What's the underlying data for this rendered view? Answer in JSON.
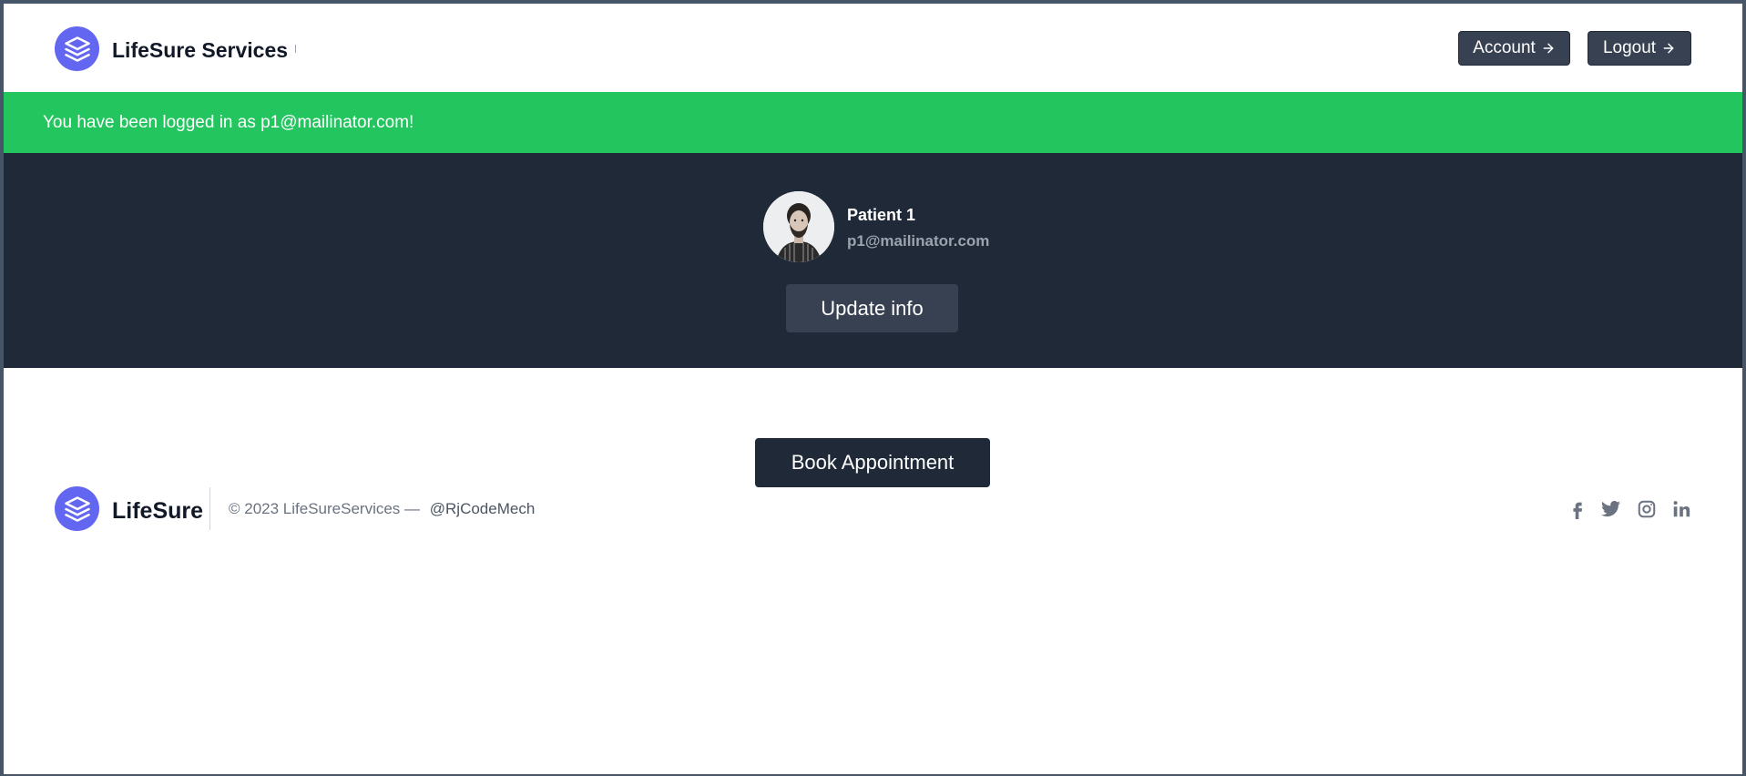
{
  "header": {
    "brand_name": "LifeSure Services",
    "logo_icon": "layers-icon",
    "account_label": "Account",
    "logout_label": "Logout",
    "arrow_icon": "arrow-right-icon"
  },
  "alert": {
    "message": "You have been logged in as p1@mailinator.com!",
    "color": "#22c55e"
  },
  "profile": {
    "name": "Patient 1",
    "email": "p1@mailinator.com",
    "update_label": "Update info",
    "background": "#1f2937"
  },
  "main": {
    "book_label": "Book Appointment"
  },
  "footer": {
    "brand_name": "LifeSure",
    "copyright": "© 2023 LifeSureServices —",
    "handle": "@RjCodeMech",
    "social_icons": [
      "facebook-icon",
      "twitter-icon",
      "instagram-icon",
      "linkedin-icon"
    ]
  },
  "colors": {
    "accent": "#6366f1",
    "button_dark": "#374151",
    "text_dark": "#111827"
  }
}
